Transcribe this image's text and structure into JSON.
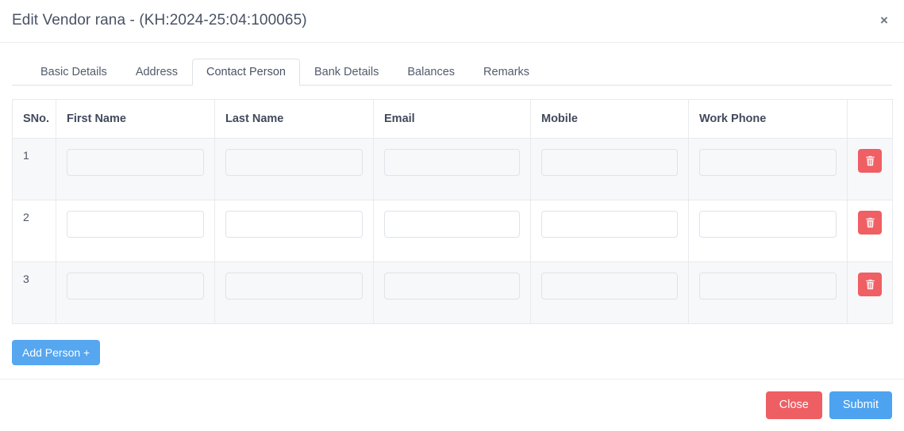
{
  "modal": {
    "title": "Edit Vendor rana - (KH:2024-25:04:100065)",
    "close_icon_label": "×"
  },
  "tabs": [
    {
      "label": "Basic Details",
      "active": false
    },
    {
      "label": "Address",
      "active": false
    },
    {
      "label": "Contact Person",
      "active": true
    },
    {
      "label": "Bank Details",
      "active": false
    },
    {
      "label": "Balances",
      "active": false
    },
    {
      "label": "Remarks",
      "active": false
    }
  ],
  "table": {
    "headers": [
      "SNo.",
      "First Name",
      "Last Name",
      "Email",
      "Mobile",
      "Work Phone",
      ""
    ],
    "rows": [
      {
        "sno": "1",
        "first_name": "",
        "last_name": "",
        "email": "",
        "mobile": "",
        "work_phone": "",
        "delete_label": "Delete"
      },
      {
        "sno": "2",
        "first_name": "",
        "last_name": "",
        "email": "",
        "mobile": "",
        "work_phone": "",
        "delete_label": "Delete"
      },
      {
        "sno": "3",
        "first_name": "",
        "last_name": "",
        "email": "",
        "mobile": "",
        "work_phone": "",
        "delete_label": "Delete"
      }
    ]
  },
  "actions": {
    "add_person_label": "Add Person +",
    "close_label": "Close",
    "submit_label": "Submit"
  },
  "colors": {
    "primary_blue": "#4da3ef",
    "add_blue": "#56a6f0",
    "danger_red": "#ee5f63",
    "delete_red": "#ef5f63",
    "text_dark": "#3e4656",
    "border_light": "#e8eaed",
    "stripe_bg": "#f7f8fa"
  }
}
